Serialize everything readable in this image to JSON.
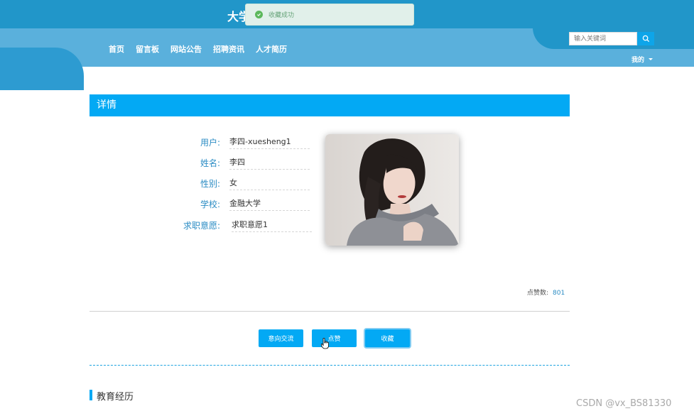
{
  "header": {
    "site_title": "大学",
    "toast_text": "收藏成功",
    "menu": [
      "首页",
      "留言板",
      "网站公告",
      "招聘资讯",
      "人才简历"
    ],
    "search_placeholder": "输入关键词",
    "mine_label": "我的"
  },
  "detail": {
    "section_title": "详情",
    "fields": [
      {
        "label": "用户:",
        "value": "李四-xuesheng1"
      },
      {
        "label": "姓名:",
        "value": "李四"
      },
      {
        "label": "性别:",
        "value": "女"
      },
      {
        "label": "学校:",
        "value": "金融大学"
      },
      {
        "label": "求职意愿:",
        "value": "求职意愿1"
      }
    ],
    "likes_label": "点赞数:",
    "likes_count": "801",
    "buttons": {
      "contact": "意向交流",
      "like": "点赞",
      "favorite": "收藏"
    }
  },
  "education": {
    "title": "教育经历"
  },
  "watermark": "CSDN @vx_BS81330",
  "colors": {
    "primary": "#03a9f4",
    "header_dark": "#2196c9",
    "header_light": "#5ab0dc",
    "toast_bg": "#e1f0ea"
  }
}
